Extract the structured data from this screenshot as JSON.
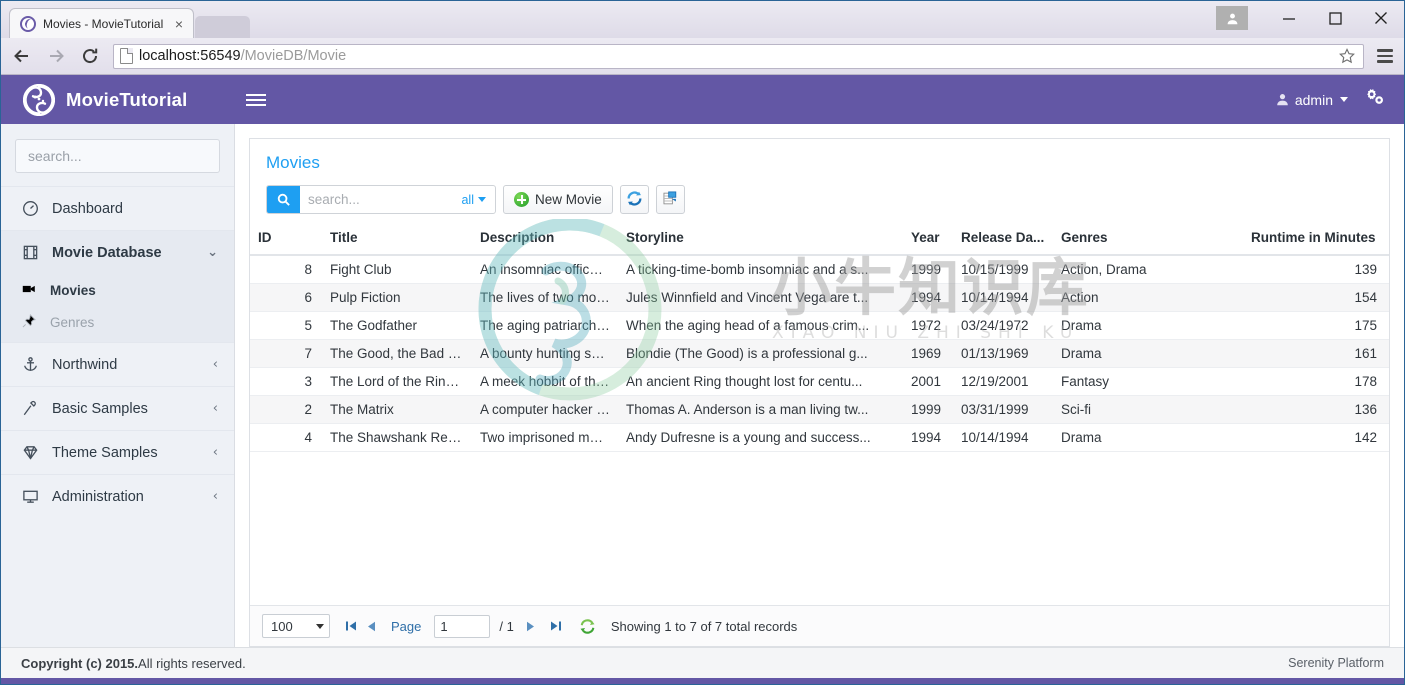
{
  "browser": {
    "tab_title": "Movies - MovieTutorial",
    "tab_close": "×",
    "url_host": "localhost:56549",
    "url_path": "/MovieDB/Movie",
    "back_icon": "back-arrow-icon",
    "forward_icon": "forward-arrow-icon",
    "reload_icon": "reload-icon",
    "bookmark_icon": "star-icon",
    "menu_icon": "hamburger-menu-icon",
    "minimize": "—",
    "maximize": "□",
    "close": "✕"
  },
  "appbar": {
    "brand": "MovieTutorial",
    "brand_logo_icon": "serenity-swirl-logo",
    "toggle_icon": "sidebar-toggle-icon",
    "user_label": "admin",
    "user_icon": "user-icon",
    "settings_icon": "gear-cogs-icon"
  },
  "sidebar": {
    "search_placeholder": "search...",
    "search_value": "",
    "search_icon": "search-icon",
    "items": [
      {
        "label": "Dashboard",
        "icon": "dashboard-gauge-icon",
        "chevron": ""
      },
      {
        "label": "Movie Database",
        "icon": "film-strip-icon",
        "chevron": "⌄",
        "expanded": true
      },
      {
        "label": "Northwind",
        "icon": "anchor-icon",
        "chevron": "‹"
      },
      {
        "label": "Basic Samples",
        "icon": "magic-wand-icon",
        "chevron": "‹"
      },
      {
        "label": "Theme Samples",
        "icon": "diamond-icon",
        "chevron": "‹"
      },
      {
        "label": "Administration",
        "icon": "monitor-icon",
        "chevron": "‹"
      }
    ],
    "subitems": [
      {
        "label": "Movies",
        "icon": "video-camera-icon",
        "active": true
      },
      {
        "label": "Genres",
        "icon": "pin-icon",
        "active": false
      }
    ]
  },
  "panel": {
    "title": "Movies",
    "search_placeholder": "search...",
    "search_value": "",
    "search_icon": "search-icon",
    "search_field_label": "all",
    "new_button": "New Movie",
    "new_button_icon": "plus-circle-green-icon",
    "refresh_button_icon": "refresh-blue-icon",
    "export_button_icon": "export-columns-icon"
  },
  "grid": {
    "columns": [
      "ID",
      "Title",
      "Description",
      "Storyline",
      "Year",
      "Release Da...",
      "Genres",
      "Runtime in Minutes"
    ],
    "rows": [
      {
        "id": "8",
        "title": "Fight Club",
        "description": "An insomniac office w...",
        "storyline": "A ticking-time-bomb insomniac and a s...",
        "year": "1999",
        "release": "10/15/1999",
        "genres": "Action, Drama",
        "runtime": "139"
      },
      {
        "id": "6",
        "title": "Pulp Fiction",
        "description": "The lives of two mob ...",
        "storyline": "Jules Winnfield and Vincent Vega are t...",
        "year": "1994",
        "release": "10/14/1994",
        "genres": "Action",
        "runtime": "154"
      },
      {
        "id": "5",
        "title": "The Godfather",
        "description": "The aging patriarch of...",
        "storyline": "When the aging head of a famous crim...",
        "year": "1972",
        "release": "03/24/1972",
        "genres": "Drama",
        "runtime": "175"
      },
      {
        "id": "7",
        "title": "The Good, the Bad an...",
        "description": "A bounty hunting sca...",
        "storyline": "Blondie (The Good) is a professional g...",
        "year": "1969",
        "release": "01/13/1969",
        "genres": "Drama",
        "runtime": "161"
      },
      {
        "id": "3",
        "title": "The Lord of the Rings:...",
        "description": "A meek hobbit of the ...",
        "storyline": "An ancient Ring thought lost for centu...",
        "year": "2001",
        "release": "12/19/2001",
        "genres": "Fantasy",
        "runtime": "178"
      },
      {
        "id": "2",
        "title": "The Matrix",
        "description": "A computer hacker le...",
        "storyline": "Thomas A. Anderson is a man living tw...",
        "year": "1999",
        "release": "03/31/1999",
        "genres": "Sci-fi",
        "runtime": "136"
      },
      {
        "id": "4",
        "title": "The Shawshank Rede...",
        "description": "Two imprisoned men ...",
        "storyline": "Andy Dufresne is a young and success...",
        "year": "1994",
        "release": "10/14/1994",
        "genres": "Drama",
        "runtime": "142"
      }
    ]
  },
  "pager": {
    "page_size": "100",
    "first_icon": "first-page-icon",
    "prev_icon": "prev-page-icon",
    "page_label": "Page",
    "page_value": "1",
    "page_total": "/ 1",
    "next_icon": "next-page-icon",
    "last_icon": "last-page-icon",
    "refresh_icon": "refresh-green-icon",
    "status": "Showing 1 to 7 of 7 total records"
  },
  "footer": {
    "copyright_strong": "Copyright (c) 2015.",
    "copyright_rest": " All rights reserved.",
    "right": "Serenity Platform"
  },
  "watermark": {
    "text": "小牛知识库",
    "sub": "XIAO NIU ZHI SHI KU"
  },
  "colors": {
    "appbar": "#6357a5",
    "accent_blue": "#1e9ff2",
    "sidebar_bg": "#eef1f6",
    "link_purple": "#5c4a90"
  }
}
